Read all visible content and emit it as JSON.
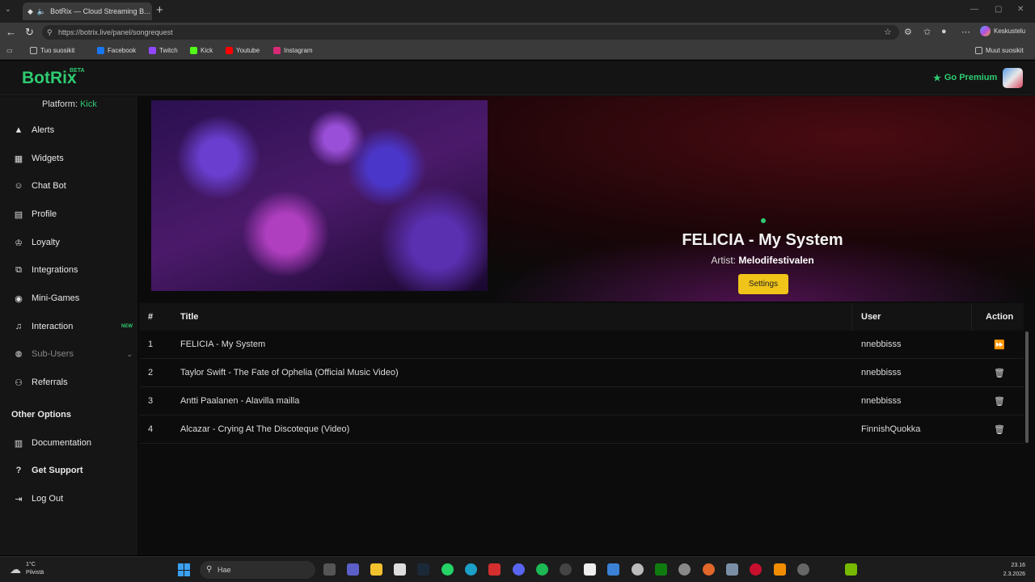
{
  "browser": {
    "tab_title": "BotRix — Cloud Streaming B...",
    "url": "https://botrix.live/panel/songrequest",
    "copilot_label": "Keskustelu",
    "bookmarks": [
      "Tuo suosikit",
      "Facebook",
      "Twitch",
      "Kick",
      "Youtube",
      "Instagram"
    ],
    "other_bookmarks": "Muut suosikit"
  },
  "header": {
    "logo": "BotRix",
    "beta": "BETA",
    "premium": "Go Premium"
  },
  "sidebar": {
    "platform_label": "Platform:",
    "platform_value": "Kick",
    "items": [
      {
        "label": "Alerts",
        "icon": "warning-icon"
      },
      {
        "label": "Widgets",
        "icon": "grid-icon"
      },
      {
        "label": "Chat Bot",
        "icon": "robot-icon"
      },
      {
        "label": "Profile",
        "icon": "id-card-icon"
      },
      {
        "label": "Loyalty",
        "icon": "trophy-icon"
      },
      {
        "label": "Integrations",
        "icon": "cubes-icon"
      },
      {
        "label": "Mini-Games",
        "icon": "gamepad-icon"
      },
      {
        "label": "Interaction",
        "icon": "music-icon",
        "badge": "NEW"
      },
      {
        "label": "Sub-Users",
        "icon": "users-icon"
      },
      {
        "label": "Referrals",
        "icon": "referral-icon"
      }
    ],
    "other_heading": "Other Options",
    "other_items": [
      {
        "label": "Documentation",
        "icon": "book-icon"
      },
      {
        "label": "Get Support",
        "icon": "question-icon"
      },
      {
        "label": "Log Out",
        "icon": "logout-icon"
      }
    ]
  },
  "now_playing": {
    "title": "FELICIA - My System",
    "artist_label": "Artist:",
    "artist": "Melodifestivalen",
    "settings": "Settings"
  },
  "queue": {
    "headers": {
      "num": "#",
      "title": "Title",
      "user": "User",
      "action": "Action"
    },
    "rows": [
      {
        "num": "1",
        "title": "FELICIA - My System",
        "user": "nnebbisss",
        "action": "skip-icon"
      },
      {
        "num": "2",
        "title": "Taylor Swift - The Fate of Ophelia (Official Music Video)",
        "user": "nnebbisss",
        "action": "trash-icon"
      },
      {
        "num": "3",
        "title": "Antti Paalanen - Alavilla mailla",
        "user": "nnebbisss",
        "action": "trash-icon"
      },
      {
        "num": "4",
        "title": "Alcazar - Crying At The Discoteque (Video)",
        "user": "FinnishQuokka",
        "action": "trash-icon"
      }
    ]
  },
  "taskbar": {
    "temp": "1°C",
    "weather": "Pilvistä",
    "search": "Hae",
    "time": "23.16",
    "date": "2.3.2026"
  }
}
